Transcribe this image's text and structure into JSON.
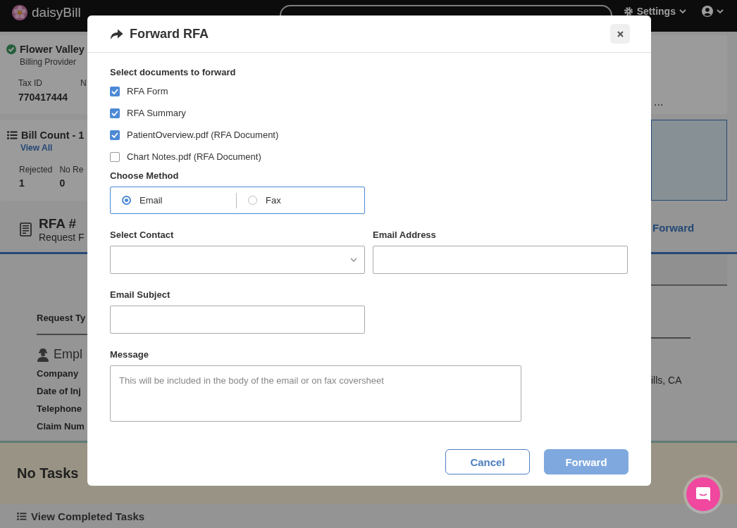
{
  "navbar": {
    "logo": "daisyBill",
    "settings": "Settings"
  },
  "provider_card": {
    "name": "Flower Valley",
    "role": "Billing Provider",
    "fields": [
      {
        "label": "Tax ID",
        "value": "770417444"
      },
      {
        "label": "N"
      }
    ],
    "overflow": "..."
  },
  "bill_count": {
    "title": "Bill Count - 1",
    "link": "View All",
    "stats": [
      {
        "label": "Rejected",
        "value": "1"
      },
      {
        "label": "No Re",
        "value": "0"
      }
    ]
  },
  "rfa": {
    "title": "RFA #",
    "subtitle": "Request F",
    "action": "Forward",
    "request_type_label": "Request Ty",
    "section_title": "Empl",
    "fields": [
      "Company",
      "Date of Inj",
      "Telephone",
      "Claim Num"
    ],
    "location": "ills, CA"
  },
  "tasks": {
    "empty": "No Tasks",
    "link": "View Completed Tasks"
  },
  "dialog": {
    "title": "Forward RFA",
    "documents_label": "Select documents to forward",
    "documents": [
      {
        "label": "RFA Form",
        "checked": true
      },
      {
        "label": "RFA Summary",
        "checked": true
      },
      {
        "label": "PatientOverview.pdf (RFA Document)",
        "checked": true
      },
      {
        "label": "Chart Notes.pdf (RFA Document)",
        "checked": false
      }
    ],
    "method_label": "Choose Method",
    "methods": [
      {
        "label": "Email",
        "selected": true
      },
      {
        "label": "Fax",
        "selected": false
      }
    ],
    "contact_label": "Select Contact",
    "email_label": "Email Address",
    "subject_label": "Email Subject",
    "message_label": "Message",
    "message_placeholder": "This will be included in the body of the email or on fax coversheet",
    "buttons": [
      {
        "label": "Cancel",
        "kind": "secondary",
        "disabled": false
      },
      {
        "label": "Forward",
        "kind": "primary",
        "disabled": true
      }
    ]
  }
}
